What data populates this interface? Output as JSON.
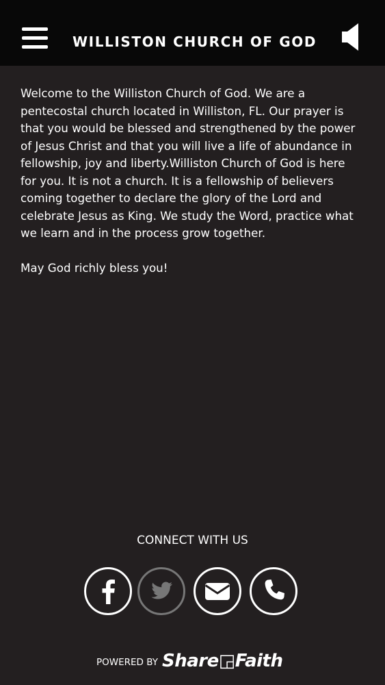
{
  "header": {
    "title": "WILLISTON CHURCH OF GOD",
    "menu_icon": "hamburger-menu-icon",
    "audio_icon": "speaker-icon"
  },
  "content": {
    "paragraphs": [
      "Welcome to the Williston Church of God. We are a pentecostal church located in Williston, FL. Our prayer is that you would be blessed and strengthened by the power of Jesus Christ and that you will live a life of abundance in fellowship, joy and liberty.Williston Church of God is here for you. It is not a church. It is a fellowship of believers coming together to declare the glory of the Lord and celebrate Jesus as King. We study the Word, practice what we learn and in the process grow together.",
      "May God richly bless you!"
    ]
  },
  "connect": {
    "heading": "CONNECT WITH US",
    "buttons": [
      {
        "icon": "facebook-icon"
      },
      {
        "icon": "twitter-icon"
      },
      {
        "icon": "email-icon"
      },
      {
        "icon": "phone-icon"
      }
    ]
  },
  "footer": {
    "powered_label": "POWERED BY",
    "brand": "Share◲Faith"
  },
  "colors": {
    "header_bg": "#080808",
    "page_bg": "#231f20",
    "text": "#ffffff",
    "dim_icon": "#777777"
  }
}
